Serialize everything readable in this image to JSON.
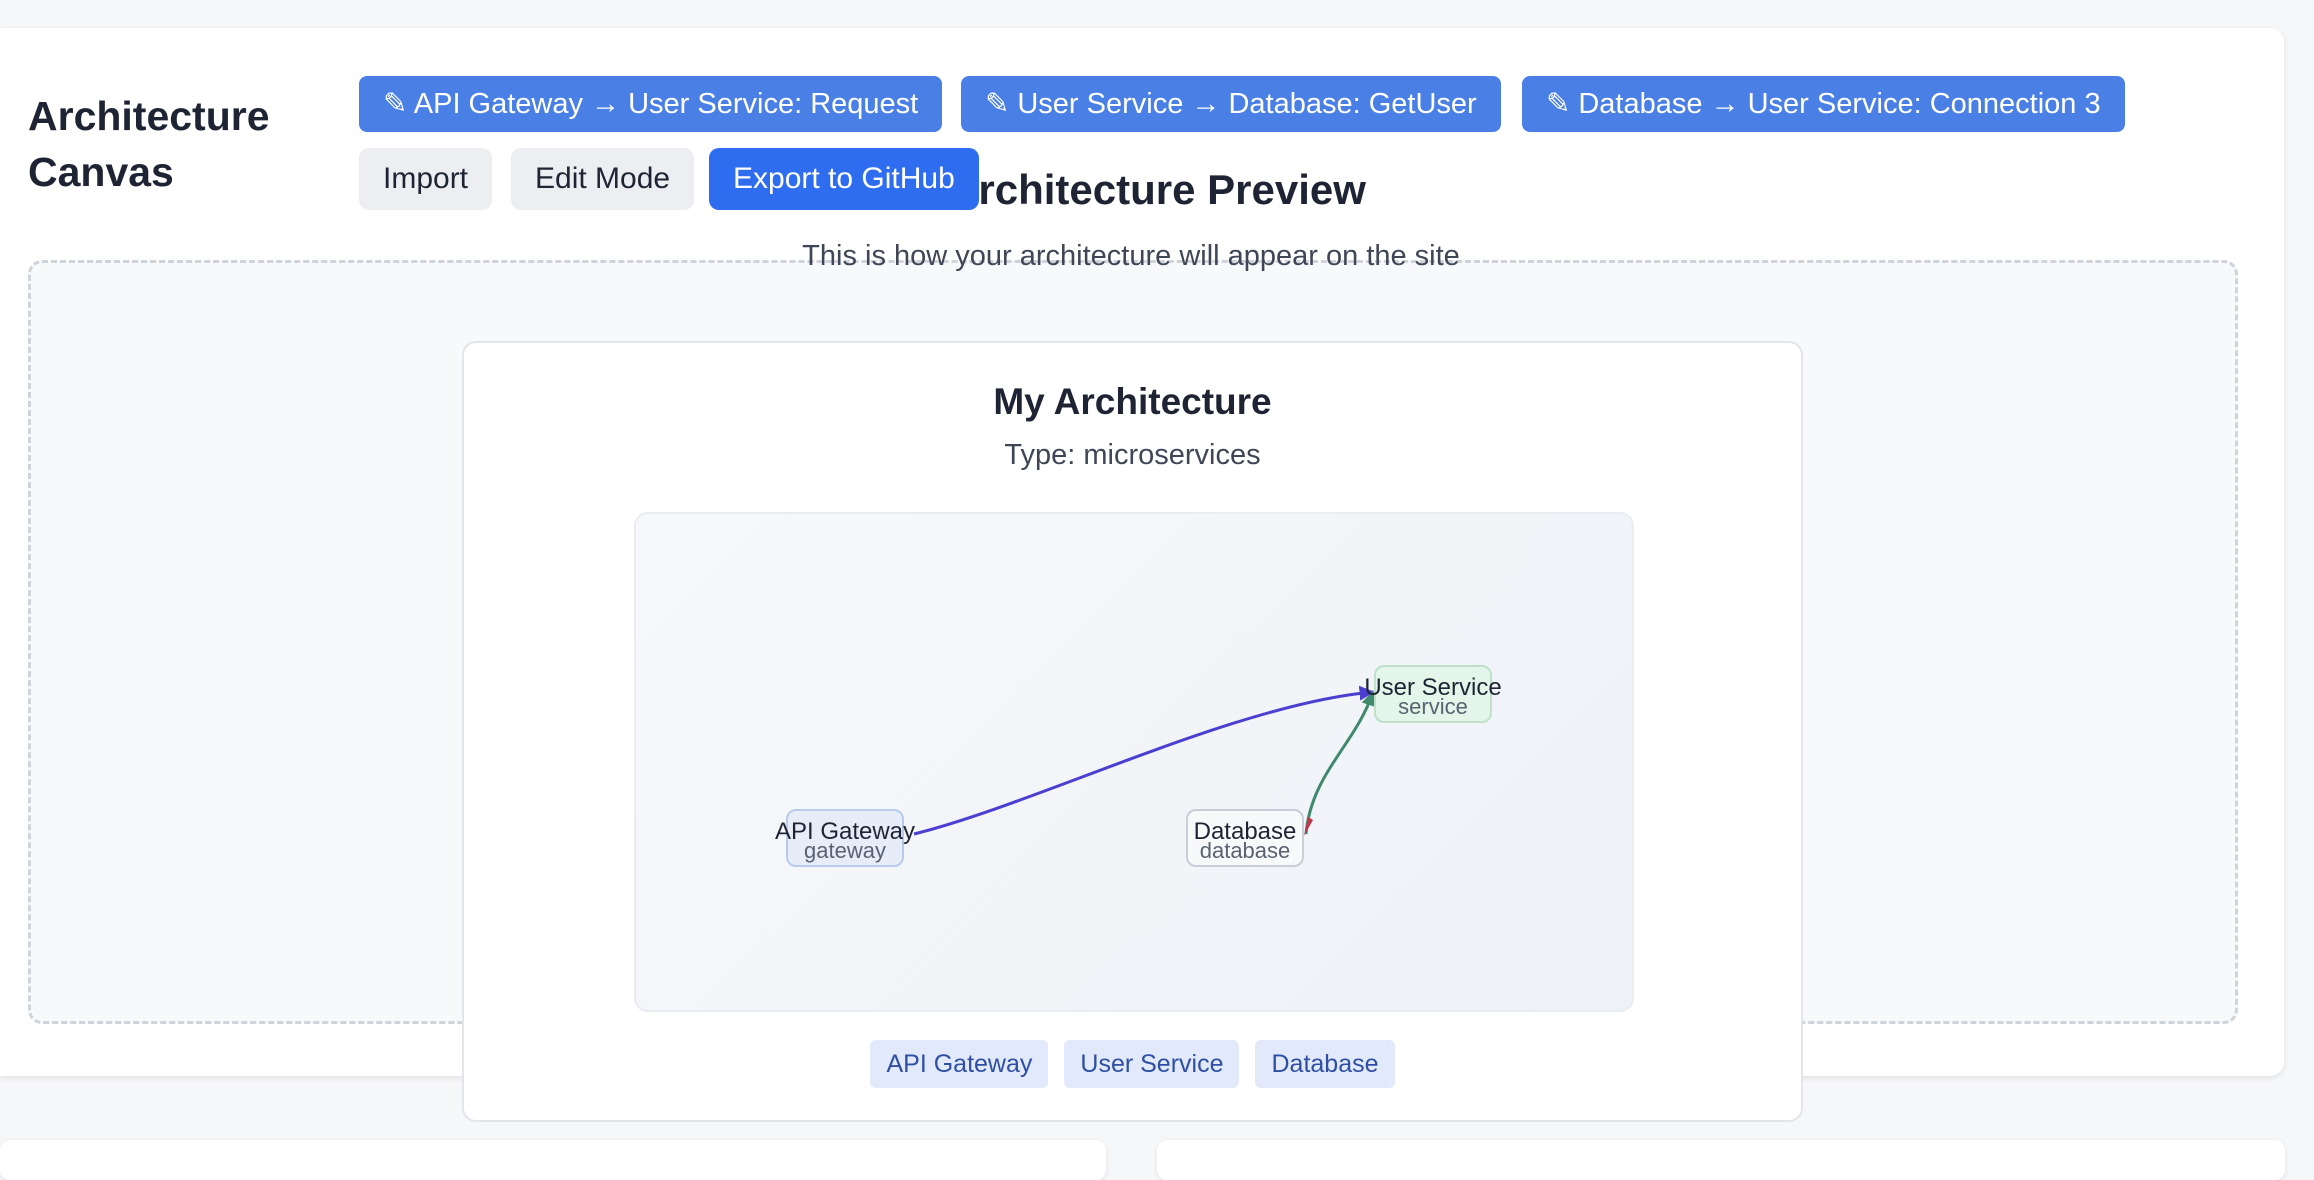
{
  "header": {
    "title": "Architecture Canvas"
  },
  "connections": [
    {
      "label": "✎ API Gateway → User Service: Request"
    },
    {
      "label": "✎ User Service → Database: GetUser"
    },
    {
      "label": "✎ Database → User Service: Connection 3"
    }
  ],
  "toolbar": {
    "import_label": "Import",
    "edit_mode_label": "Edit Mode",
    "export_label": "Export to GitHub"
  },
  "preview": {
    "heading": "Architecture Preview",
    "subtitle": "This is how your architecture will appear on the site",
    "card": {
      "title": "My Architecture",
      "type_text": "Type: microservices",
      "nodes": [
        {
          "label": "API Gateway",
          "type": "gateway",
          "color": "#e6edf9"
        },
        {
          "label": "User Service",
          "type": "service",
          "color": "#e3f6e9"
        },
        {
          "label": "Database",
          "type": "database",
          "color": "#f8f9fb"
        }
      ],
      "edge_colors": {
        "request": "#4b3fd1",
        "connection": "#3f8a6c",
        "getuser": "#c2364a"
      },
      "chips": [
        "API Gateway",
        "User Service",
        "Database"
      ]
    }
  }
}
